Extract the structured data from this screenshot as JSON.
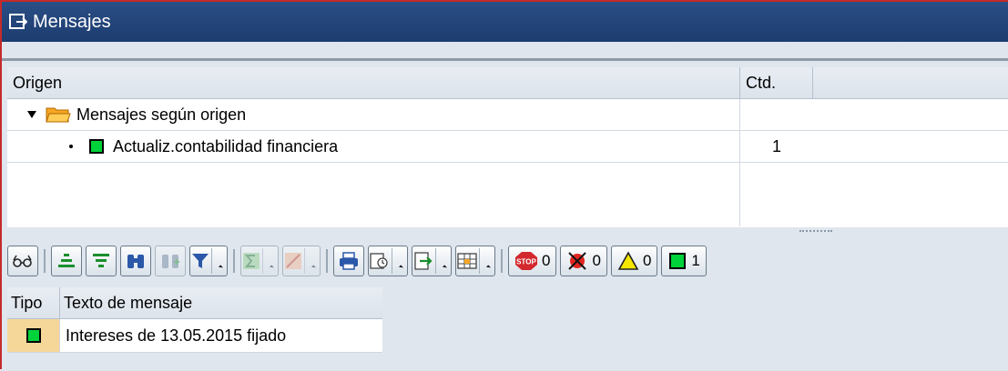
{
  "window": {
    "title": "Mensajes"
  },
  "tree": {
    "columns": [
      "Origen",
      "Ctd."
    ],
    "rows": [
      {
        "label": "Mensajes según origen",
        "count": ""
      },
      {
        "label": "Actualiz.contabilidad financiera",
        "count": "1"
      }
    ]
  },
  "toolbar": {
    "status_counts": {
      "stop": "0",
      "error": "0",
      "warning": "0",
      "success": "1"
    }
  },
  "messages": {
    "columns": [
      "Tipo",
      "Texto de mensaje"
    ],
    "rows": [
      {
        "type": "success",
        "text": "Intereses de 13.05.2015 fijado"
      }
    ]
  },
  "colors": {
    "title_bar": "#1d3c6f",
    "success": "#00d33a",
    "stop": "#d3282d",
    "warning": "#f5e600"
  }
}
